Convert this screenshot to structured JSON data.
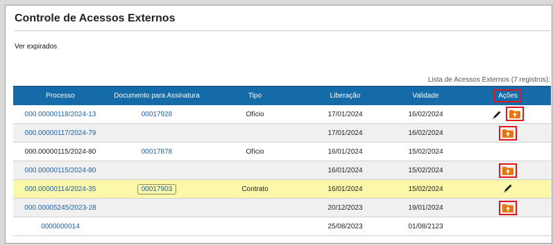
{
  "page": {
    "title": "Controle de Acessos Externos",
    "expired_link": "Ver expirados",
    "caption": "Lista de Acessos Externos (7 registros):"
  },
  "table": {
    "headers": [
      "Processo",
      "Documento para Assinatura",
      "Tipo",
      "Liberação",
      "Validade",
      "Ações"
    ],
    "rows": [
      {
        "processo": "000.00000118/2024-13",
        "documento": "00017928",
        "tipo": "Ofício",
        "liberacao": "17/01/2024",
        "validade": "16/02/2024",
        "actions": [
          "pen-icon",
          "folder-upload-icon"
        ]
      },
      {
        "processo": "000.00000117/2024-79",
        "documento": "",
        "tipo": "",
        "liberacao": "17/01/2024",
        "validade": "16/02/2024",
        "actions": [
          "folder-upload-icon"
        ]
      },
      {
        "processo": "000.00000115/2024-80",
        "documento": "00017878",
        "tipo": "Ofício",
        "liberacao": "16/01/2024",
        "validade": "15/02/2024",
        "actions": []
      },
      {
        "processo": "000.00000115/2024-80",
        "documento": "",
        "tipo": "",
        "liberacao": "16/01/2024",
        "validade": "15/02/2024",
        "actions": [
          "folder-upload-icon"
        ]
      },
      {
        "processo": "000.00000114/2024-35",
        "documento": "00017903",
        "tipo": "Contrato",
        "liberacao": "16/01/2024",
        "validade": "15/02/2024",
        "actions": [
          "pen-icon"
        ]
      },
      {
        "processo": "000.00005245/2023-28",
        "documento": "",
        "tipo": "",
        "liberacao": "20/12/2023",
        "validade": "19/01/2024",
        "actions": [
          "folder-upload-icon"
        ]
      },
      {
        "processo": "0000000014",
        "documento": "",
        "tipo": "",
        "liberacao": "25/08/2023",
        "validade": "01/08/2123",
        "actions": []
      }
    ]
  },
  "colors": {
    "header_bg": "#156aa8",
    "link": "#1d5fa8",
    "highlight_row": "#fbf9a9",
    "annotation_red": "#e0161b",
    "folder_orange": "#e8760f"
  }
}
